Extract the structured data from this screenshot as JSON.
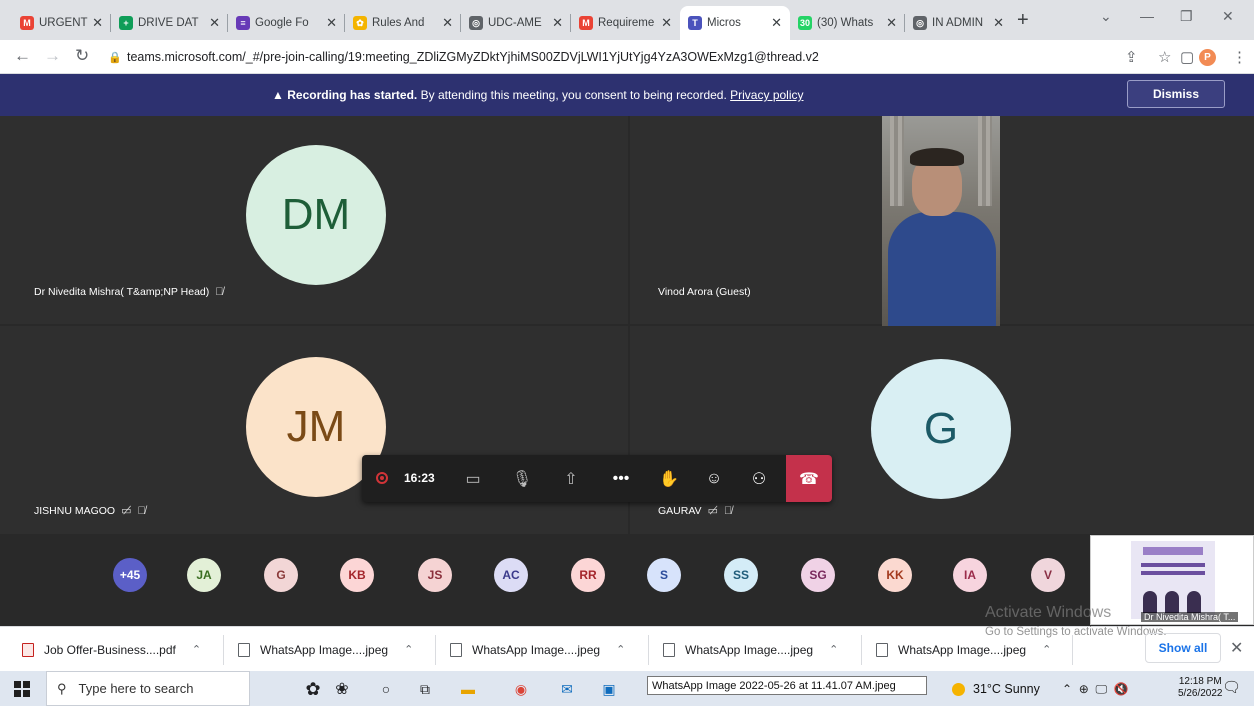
{
  "tabs": [
    {
      "title": "URGENT a",
      "favicon": "gmail-icon",
      "color": "#ea4335",
      "letter": "M"
    },
    {
      "title": "DRIVE DAT",
      "favicon": "sheets-icon",
      "color": "#0f9d58",
      "letter": "+"
    },
    {
      "title": "Google Fo",
      "favicon": "forms-icon",
      "color": "#673ab7",
      "letter": "≡"
    },
    {
      "title": "Rules And",
      "favicon": "gear-icon",
      "color": "#f4b400",
      "letter": "✿"
    },
    {
      "title": "UDC-AME",
      "favicon": "globe-icon",
      "color": "#5f6368",
      "letter": "◎"
    },
    {
      "title": "Requireme",
      "favicon": "gmail-icon",
      "color": "#ea4335",
      "letter": "M"
    },
    {
      "title": "Micros",
      "favicon": "teams-icon",
      "color": "#4b53bc",
      "letter": "T",
      "active": true
    },
    {
      "title": "(30) Whats",
      "favicon": "whatsapp-icon",
      "color": "#25d366",
      "letter": "30"
    },
    {
      "title": "IN ADMIN",
      "favicon": "globe-icon",
      "color": "#5f6368",
      "letter": "◎"
    }
  ],
  "address": {
    "url": "teams.microsoft.com/_#/pre-join-calling/19:meeting_ZDliZGMyZDktYjhiMS00ZDVjLWI1YjUtYjg4YzA3OWExMzg1@thread.v2"
  },
  "profile_letter": "P",
  "banner": {
    "bold": "Recording has started.",
    "text": " By attending this meeting, you consent to being recorded. ",
    "link": "Privacy policy",
    "dismiss": "Dismiss"
  },
  "participants": {
    "dm": {
      "initials": "DM",
      "name": "Dr Nivedita Mishra( T&amp;NP Head)"
    },
    "vinod": {
      "name": "Vinod Arora (Guest)"
    },
    "jm": {
      "initials": "JM",
      "name": "JISHNU MAGOO"
    },
    "g": {
      "initials": "G",
      "name": "GAURAV"
    }
  },
  "controls": {
    "timer": "16:23"
  },
  "strip": [
    {
      "label": "+45",
      "bg": "#5b5fc7",
      "fg": "#ffffff"
    },
    {
      "label": "JA",
      "bg": "#e3f0d7",
      "fg": "#3b6e22"
    },
    {
      "label": "G",
      "bg": "#f2d6d6",
      "fg": "#8a3a3a"
    },
    {
      "label": "KB",
      "bg": "#fcd6d6",
      "fg": "#a4262c"
    },
    {
      "label": "JS",
      "bg": "#f5d3d3",
      "fg": "#8a2f3b"
    },
    {
      "label": "AC",
      "bg": "#dcdcf5",
      "fg": "#3b3a8c"
    },
    {
      "label": "RR",
      "bg": "#fcd6d6",
      "fg": "#a4262c"
    },
    {
      "label": "S",
      "bg": "#d7e3fb",
      "fg": "#2b4c9b"
    },
    {
      "label": "SS",
      "bg": "#d4ecf7",
      "fg": "#1f5c7a"
    },
    {
      "label": "SG",
      "bg": "#f0d2e6",
      "fg": "#7a2a5e"
    },
    {
      "label": "KK",
      "bg": "#fbd9d0",
      "fg": "#a33a1e"
    },
    {
      "label": "IA",
      "bg": "#f7d4de",
      "fg": "#9b2b4a"
    },
    {
      "label": "V",
      "bg": "#f0d6dc",
      "fg": "#8a2f45"
    }
  ],
  "thumbnail": {
    "name": "Dr Nivedita Mishra( T..."
  },
  "watermark": {
    "line1": "Activate Windows",
    "line2": "Go to Settings to activate Windows."
  },
  "downloads": [
    {
      "name": "Job Offer-Business....pdf",
      "type": "pdf"
    },
    {
      "name": "WhatsApp Image....jpeg",
      "type": "img"
    },
    {
      "name": "WhatsApp Image....jpeg",
      "type": "img"
    },
    {
      "name": "WhatsApp Image....jpeg",
      "type": "img"
    },
    {
      "name": "WhatsApp Image....jpeg",
      "type": "img"
    }
  ],
  "show_all": "Show all",
  "taskbar": {
    "search_placeholder": "Type here to search",
    "tooltip": "WhatsApp Image 2022-05-26 at 11.41.07 AM.jpeg",
    "weather": "31°C  Sunny",
    "time": "12:18 PM",
    "date": "5/26/2022"
  },
  "colors": {
    "banner": "#2d3170",
    "hangup": "#c4314b",
    "stage": "#292929"
  }
}
